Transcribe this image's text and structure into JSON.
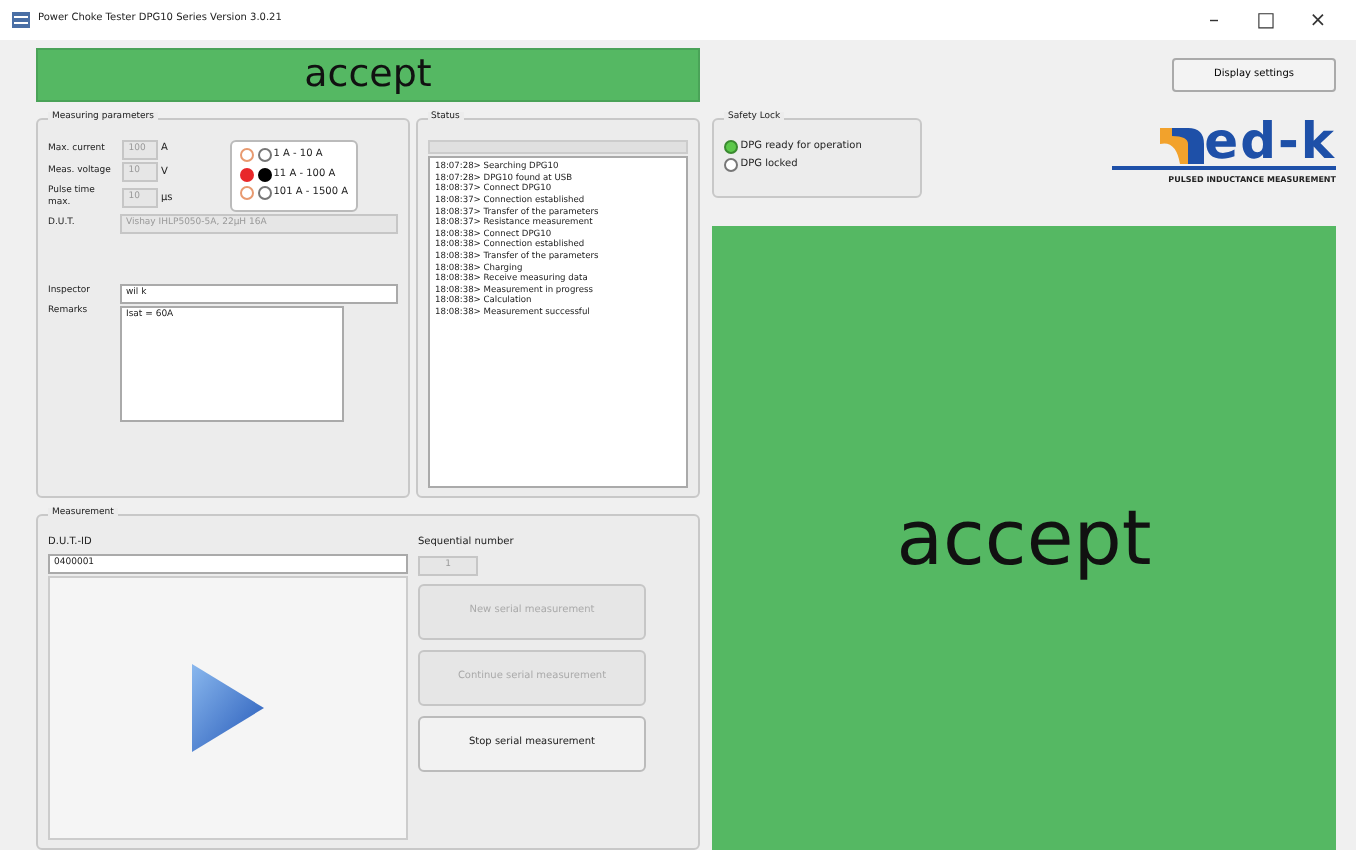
{
  "window": {
    "title": "Power Choke Tester DPG10 Series Version 3.0.21",
    "controls": [
      "–",
      "□",
      "×"
    ]
  },
  "result_banner": {
    "text": "accept"
  },
  "display_settings_button": "Display settings",
  "measuring_parameters": {
    "title": "Measuring parameters",
    "fields": [
      {
        "label": "Max. current",
        "value": "100",
        "unit": "A"
      },
      {
        "label": "Meas. voltage",
        "value": "10",
        "unit": "V"
      },
      {
        "label": "Pulse time max.",
        "value": "10",
        "unit": "µs"
      }
    ],
    "ranges": [
      {
        "label": "1 A - 10 A",
        "selected": false
      },
      {
        "label": "11 A - 100 A",
        "selected": true
      },
      {
        "label": "101 A - 1500 A",
        "selected": false
      }
    ],
    "dut": {
      "label": "D.U.T.",
      "value": "Vishay IHLP5050-5A, 22µH 16A"
    },
    "inspector": {
      "label": "Inspector",
      "value": "wil k"
    },
    "remarks": {
      "label": "Remarks",
      "value": "Isat = 60A"
    }
  },
  "status": {
    "title": "Status",
    "log": [
      "18:07:28> Searching DPG10",
      "18:07:28> DPG10 found at USB",
      "18:08:37> Connect DPG10",
      "18:08:37> Connection established",
      "18:08:37> Transfer of the parameters",
      "18:08:37> Resistance measurement",
      "18:08:38> Connect DPG10",
      "18:08:38> Connection established",
      "18:08:38> Transfer of the parameters",
      "18:08:38> Charging",
      "18:08:38> Receive measuring data",
      "18:08:38> Measurement in progress",
      "18:08:38> Calculation",
      "18:08:38> Measurement successful"
    ]
  },
  "safety_lock": {
    "title": "Safety Lock",
    "options": [
      {
        "label": "DPG ready for operation",
        "selected": true
      },
      {
        "label": "DPG locked",
        "selected": false
      }
    ]
  },
  "logo": {
    "name": "ed-k",
    "tagline": "PULSED INDUCTANCE MEASUREMENT"
  },
  "measurement": {
    "title": "Measurement",
    "dut_id": {
      "label": "D.U.T.-ID",
      "value": "0400001"
    },
    "sequential": {
      "label": "Sequential number",
      "value": "1"
    },
    "buttons": [
      {
        "label": "New serial measurement",
        "disabled": true
      },
      {
        "label": "Continue serial measurement",
        "disabled": true
      },
      {
        "label": "Stop serial measurement",
        "disabled": false
      }
    ]
  },
  "result_panel": {
    "text": "accept"
  }
}
